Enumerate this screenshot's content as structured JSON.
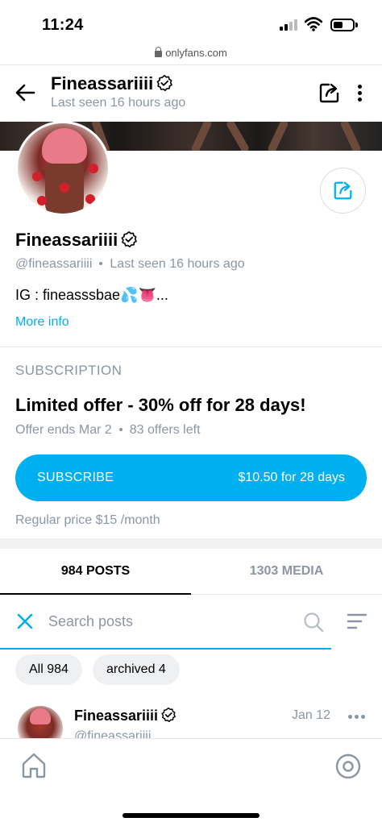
{
  "status_bar": {
    "time": "11:24"
  },
  "browser": {
    "url": "onlyfans.com"
  },
  "header": {
    "name": "Fineassariiii",
    "last_seen": "Last seen 16 hours ago"
  },
  "profile": {
    "name": "Fineassariiii",
    "handle": "@fineassariiii",
    "last_seen": "Last seen 16 hours ago",
    "bio": "IG : fineasssbae💦👅...",
    "more_info": "More info"
  },
  "subscription": {
    "section_title": "SUBSCRIPTION",
    "offer_title": "Limited offer - 30% off for 28 days!",
    "offer_ends": "Offer ends Mar 2",
    "offers_left": "83 offers left",
    "button_label": "SUBSCRIBE",
    "button_price": "$10.50 for 28 days",
    "regular_price": "Regular price $15 /month"
  },
  "tabs": [
    {
      "label": "984 POSTS",
      "active": true
    },
    {
      "label": "1303 MEDIA",
      "active": false
    }
  ],
  "search": {
    "placeholder": "Search posts"
  },
  "filters": [
    {
      "label": "All 984"
    },
    {
      "label": "archived 4"
    }
  ],
  "post": {
    "name": "Fineassariiii",
    "handle": "@fineassariiii",
    "date": "Jan 12"
  },
  "colors": {
    "accent": "#00aff0",
    "muted": "#8a96a3"
  },
  "icons": [
    "back-arrow-icon",
    "share-icon",
    "more-vertical-icon",
    "verified-icon",
    "close-icon",
    "search-icon",
    "filter-icon",
    "more-horizontal-icon",
    "home-icon",
    "profile-icon"
  ]
}
